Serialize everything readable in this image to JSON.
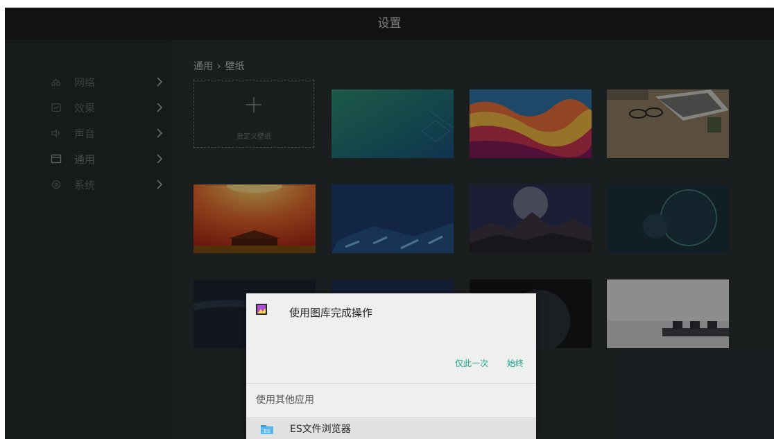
{
  "window": {
    "title": "设置"
  },
  "sidebar": {
    "items": [
      {
        "label": "网络",
        "icon": "network-icon"
      },
      {
        "label": "效果",
        "icon": "effects-icon"
      },
      {
        "label": "声音",
        "icon": "sound-icon"
      },
      {
        "label": "通用",
        "icon": "general-icon"
      },
      {
        "label": "系统",
        "icon": "system-icon"
      }
    ]
  },
  "breadcrumb": {
    "parent": "通用",
    "separator": "›",
    "current": "壁纸"
  },
  "wallpapers": {
    "add_label": "自定义壁纸",
    "thumbnails": [
      "teal-geometric",
      "colorful-waves",
      "desk-laptop",
      "palace-sunset",
      "blue-tiles",
      "planet-mountains",
      "dark-planet",
      "starry-night",
      "blue-sparkle",
      "dark-earth",
      "meeting-room"
    ]
  },
  "dialog": {
    "title": "使用图库完成操作",
    "just_once": "仅此一次",
    "always": "始终",
    "other_apps_label": "使用其他应用",
    "apps": [
      {
        "name": "ES文件浏览器",
        "icon": "es-file-explorer-icon"
      }
    ]
  },
  "colors": {
    "accent": "#1aa58c",
    "background": "#262a2c",
    "dialog": "#efefef"
  }
}
